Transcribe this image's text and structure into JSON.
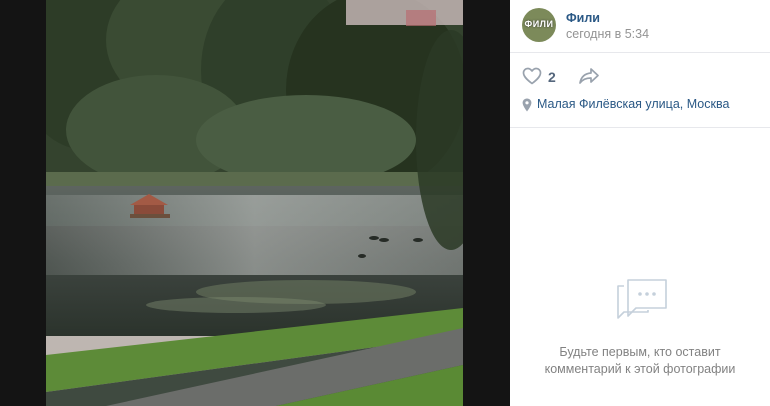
{
  "post": {
    "author_name": "Фили",
    "avatar_text": "ФИЛИ",
    "date": "сегодня в 5:34",
    "likes": "2",
    "location": "Малая Филёвская улица, Москва"
  },
  "comments": {
    "empty_line1": "Будьте первым, кто оставит",
    "empty_line2": "комментарий к этой фотографии"
  },
  "colors": {
    "link": "#2a5885",
    "muted": "#939393",
    "icon": "#99a2ad",
    "viewer_bg": "#141414"
  },
  "icons": {
    "like": "heart-icon",
    "share": "share-arrow-icon",
    "location": "location-pin-icon",
    "comments": "speech-bubble-icon"
  }
}
